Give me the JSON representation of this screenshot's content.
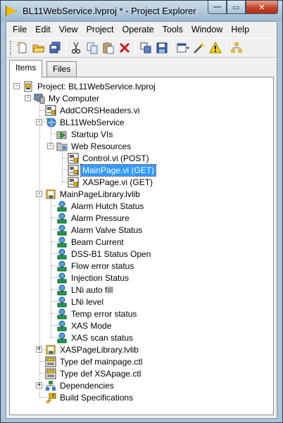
{
  "window": {
    "title": "BL11WebService.lvproj * - Project Explorer",
    "minimize": "—",
    "maximize": "▭",
    "close": "✕"
  },
  "menu": [
    "File",
    "Edit",
    "View",
    "Project",
    "Operate",
    "Tools",
    "Window",
    "Help"
  ],
  "tabs": {
    "items": "Items",
    "files": "Files"
  },
  "tree": [
    {
      "label": "Project: BL11WebService.lvproj",
      "depth": 0,
      "icon": "project-icon",
      "exp": "-"
    },
    {
      "label": "My Computer",
      "depth": 1,
      "icon": "computer-icon",
      "exp": "-"
    },
    {
      "label": "AddCORSHeaders.vi",
      "depth": 2,
      "icon": "vi-icon"
    },
    {
      "label": "BL11WebService",
      "depth": 2,
      "icon": "web-service-icon",
      "exp": "-"
    },
    {
      "label": "Startup VIs",
      "depth": 3,
      "icon": "startup-folder-icon"
    },
    {
      "label": "Web Resources",
      "depth": 3,
      "icon": "folder-icon",
      "exp": "-"
    },
    {
      "label": "Control.vi (POST)",
      "depth": 4,
      "icon": "vi-icon"
    },
    {
      "label": "MainPage.vi (GET)",
      "depth": 4,
      "icon": "vi-icon",
      "selected": true
    },
    {
      "label": "XASPage.vi (GET)",
      "depth": 4,
      "icon": "vi-icon"
    },
    {
      "label": "MainPageLibrary.lvlib",
      "depth": 2,
      "icon": "library-icon",
      "exp": "-"
    },
    {
      "label": "Alarm Hutch Status",
      "depth": 3,
      "icon": "variable-icon"
    },
    {
      "label": "Alarm Pressure",
      "depth": 3,
      "icon": "variable-icon"
    },
    {
      "label": "Alarm Valve Status",
      "depth": 3,
      "icon": "variable-icon"
    },
    {
      "label": "Beam Current",
      "depth": 3,
      "icon": "variable-icon"
    },
    {
      "label": "DSS-B1 Status Open",
      "depth": 3,
      "icon": "variable-icon"
    },
    {
      "label": "Flow error status",
      "depth": 3,
      "icon": "variable-icon"
    },
    {
      "label": "Injection Status",
      "depth": 3,
      "icon": "variable-icon"
    },
    {
      "label": "LNi auto fill",
      "depth": 3,
      "icon": "variable-icon"
    },
    {
      "label": "LNi level",
      "depth": 3,
      "icon": "variable-icon"
    },
    {
      "label": "Temp error status",
      "depth": 3,
      "icon": "variable-icon"
    },
    {
      "label": "XAS Mode",
      "depth": 3,
      "icon": "variable-icon"
    },
    {
      "label": "XAS scan status",
      "depth": 3,
      "icon": "variable-icon"
    },
    {
      "label": "XASPageLibrary.lvlib",
      "depth": 2,
      "icon": "library-icon",
      "exp": "+"
    },
    {
      "label": "Type def mainpage.ctl",
      "depth": 2,
      "icon": "ctl-icon"
    },
    {
      "label": "Type def XSApage.ctl",
      "depth": 2,
      "icon": "ctl-icon"
    },
    {
      "label": "Dependencies",
      "depth": 2,
      "icon": "dependencies-icon",
      "exp": "+"
    },
    {
      "label": "Build Specifications",
      "depth": 2,
      "icon": "build-spec-icon"
    }
  ]
}
